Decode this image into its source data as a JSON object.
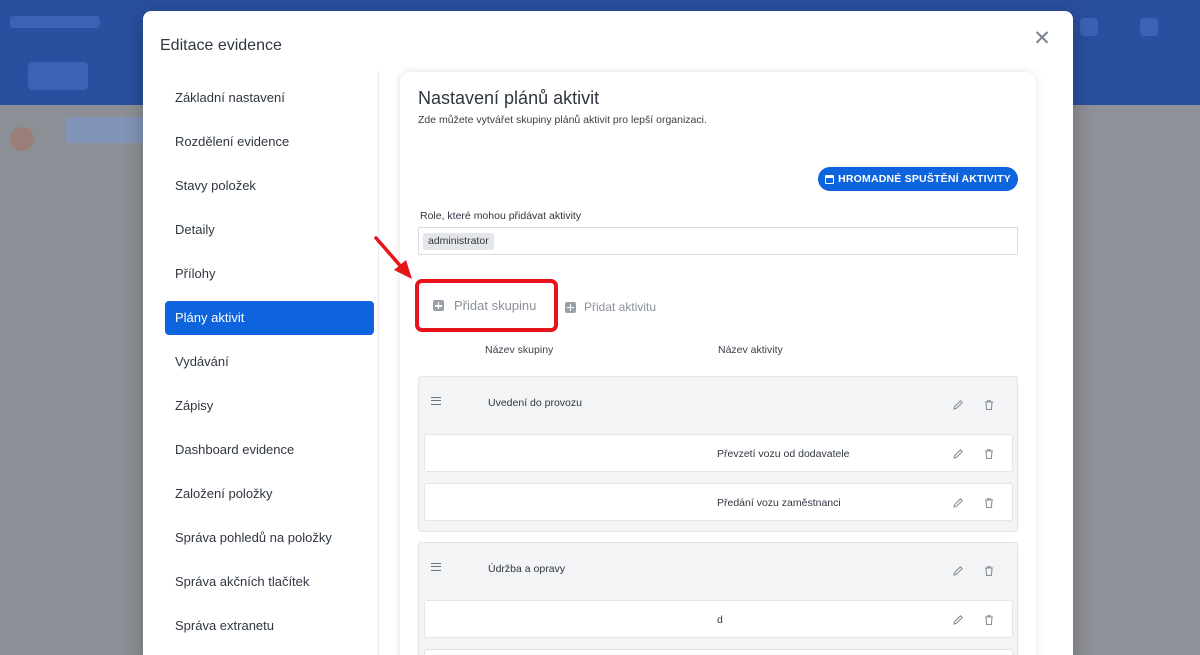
{
  "modal": {
    "title": "Editace evidence",
    "close_icon": "close-icon"
  },
  "sidebar": {
    "items": [
      {
        "label": "Základní nastavení"
      },
      {
        "label": "Rozdělení evidence"
      },
      {
        "label": "Stavy položek"
      },
      {
        "label": "Detaily"
      },
      {
        "label": "Přílohy"
      },
      {
        "label": "Plány aktivit",
        "active": true
      },
      {
        "label": "Vydávání"
      },
      {
        "label": "Zápisy"
      },
      {
        "label": "Dashboard evidence"
      },
      {
        "label": "Založení položky"
      },
      {
        "label": "Správa pohledů na položky"
      },
      {
        "label": "Správa akčních tlačítek"
      },
      {
        "label": "Správa extranetu"
      }
    ]
  },
  "content": {
    "title": "Nastavení plánů aktivit",
    "subtitle": "Zde můžete vytvářet skupiny plánů aktivit pro lepší organizaci.",
    "bulk_button": "HROMADNÉ SPUŠTĚNÍ AKTIVITY",
    "roles_label": "Role, které mohou přidávat aktivity",
    "roles": [
      "administrator"
    ],
    "add_group": "Přidat skupinu",
    "add_activity": "Přidat aktivitu",
    "columns": {
      "group": "Název skupiny",
      "activity": "Název aktivity"
    },
    "groups": [
      {
        "name": "Uvedení do provozu",
        "activities": [
          "Převzetí vozu od dodavatele",
          "Předání vozu zaměstnanci"
        ]
      },
      {
        "name": "Údržba a opravy",
        "activities": [
          "d"
        ]
      }
    ]
  },
  "colors": {
    "accent": "#0d64dc",
    "highlight": "#e8141c"
  }
}
